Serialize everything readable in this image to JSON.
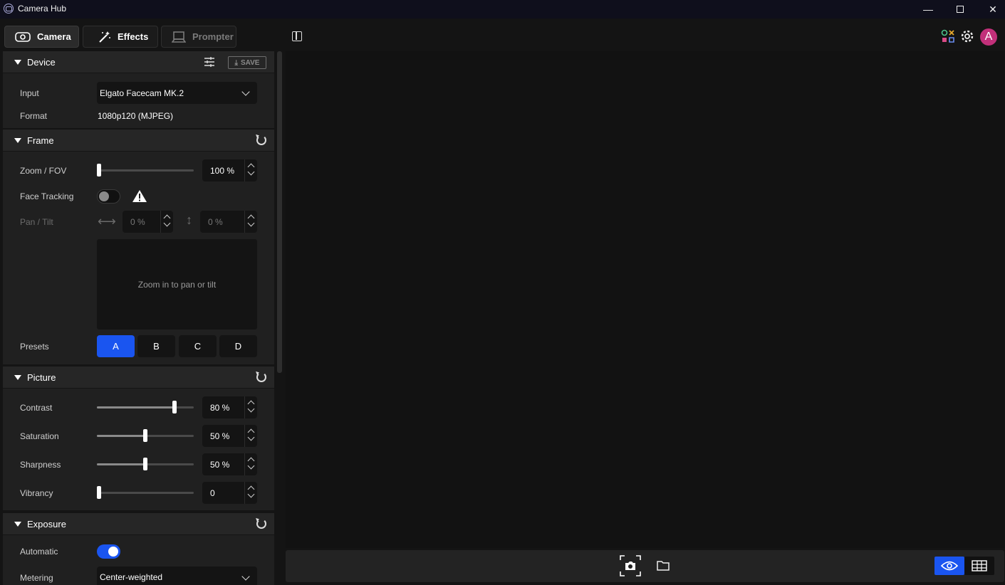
{
  "window": {
    "title": "Camera Hub",
    "minimize": "—",
    "maximize": "☐",
    "close": "✕"
  },
  "tabs": [
    {
      "label": "Camera",
      "icon": "camera-icon"
    },
    {
      "label": "Effects",
      "icon": "magic-wand-icon"
    },
    {
      "label": "Prompter",
      "icon": "prompter-icon"
    }
  ],
  "device": {
    "title": "Device",
    "save_label": "SAVE",
    "input_label": "Input",
    "input_value": "Elgato Facecam MK.2",
    "format_label": "Format",
    "format_value": "1080p120 (MJPEG)"
  },
  "frame": {
    "title": "Frame",
    "zoom_label": "Zoom / FOV",
    "zoom_value": "100 %",
    "zoom_level": 0,
    "face_tracking_label": "Face Tracking",
    "face_tracking_on": false,
    "pan_tilt_label": "Pan / Tilt",
    "pan_value": "0 %",
    "tilt_value": "0 %",
    "pan_area_text": "Zoom in to pan or tilt",
    "presets_label": "Presets",
    "presets": [
      "A",
      "B",
      "C",
      "D"
    ],
    "active_preset": "A"
  },
  "picture": {
    "title": "Picture",
    "rows": [
      {
        "label": "Contrast",
        "value": "80 %",
        "level": 0.8
      },
      {
        "label": "Saturation",
        "value": "50 %",
        "level": 0.5
      },
      {
        "label": "Sharpness",
        "value": "50 %",
        "level": 0.5
      },
      {
        "label": "Vibrancy",
        "value": "0",
        "level": 0
      }
    ]
  },
  "exposure": {
    "title": "Exposure",
    "automatic_label": "Automatic",
    "automatic_on": true,
    "metering_label": "Metering",
    "metering_value": "Center-weighted"
  },
  "colors": {
    "accent": "#1a55f0",
    "avatar": "#c2307a"
  },
  "avatar_letter": "A"
}
